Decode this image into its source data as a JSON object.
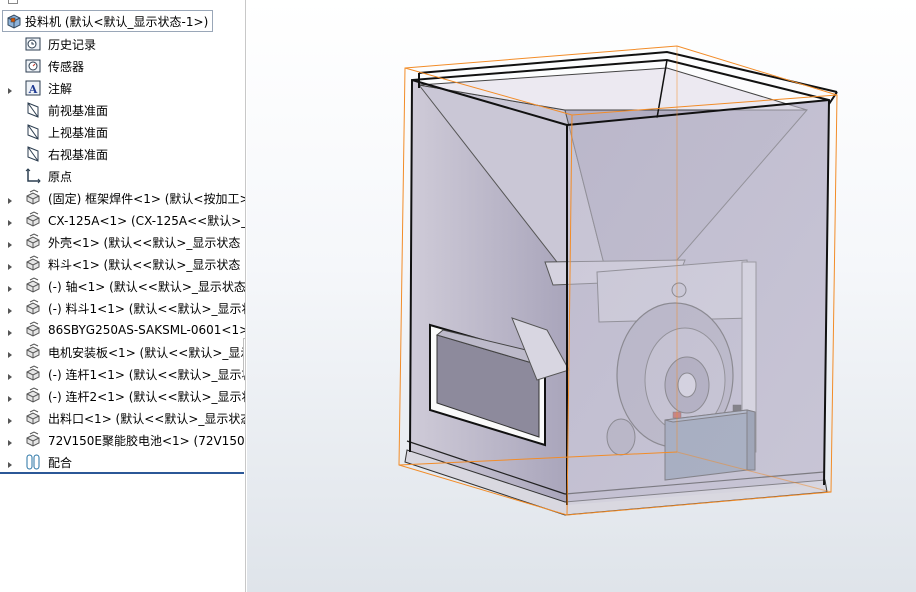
{
  "tree": {
    "root_label": "投料机  (默认<默认_显示状态-1>)",
    "items": [
      {
        "label": "历史记录",
        "icon": "history-icon",
        "expandable": false
      },
      {
        "label": "传感器",
        "icon": "sensor-icon",
        "expandable": false
      },
      {
        "label": "注解",
        "icon": "annotation-icon",
        "expandable": true
      },
      {
        "label": "前视基准面",
        "icon": "plane-icon",
        "expandable": false
      },
      {
        "label": "上视基准面",
        "icon": "plane-icon",
        "expandable": false
      },
      {
        "label": "右视基准面",
        "icon": "plane-icon",
        "expandable": false
      },
      {
        "label": "原点",
        "icon": "origin-icon",
        "expandable": false
      },
      {
        "label": "(固定) 框架焊件<1> (默认<按加工>",
        "icon": "part-icon",
        "expandable": true
      },
      {
        "label": "CX-125A<1> (CX-125A<<默认>_显",
        "icon": "part-icon",
        "expandable": true
      },
      {
        "label": "外壳<1> (默认<<默认>_显示状态 1",
        "icon": "part-icon",
        "expandable": true
      },
      {
        "label": "料斗<1> (默认<<默认>_显示状态 1",
        "icon": "part-icon",
        "expandable": true
      },
      {
        "label": "(-) 轴<1> (默认<<默认>_显示状态 1",
        "icon": "part-icon",
        "expandable": true
      },
      {
        "label": "(-) 料斗1<1> (默认<<默认>_显示状",
        "icon": "part-icon",
        "expandable": true
      },
      {
        "label": "86SBYG250AS-SAKSML-0601<1>",
        "icon": "part-icon",
        "expandable": true
      },
      {
        "label": "电机安装板<1> (默认<<默认>_显示",
        "icon": "part-icon",
        "expandable": true
      },
      {
        "label": "(-) 连杆1<1> (默认<<默认>_显示状",
        "icon": "part-icon",
        "expandable": true
      },
      {
        "label": "(-) 连杆2<1> (默认<<默认>_显示状",
        "icon": "part-icon",
        "expandable": true
      },
      {
        "label": "出料口<1> (默认<<默认>_显示状态",
        "icon": "part-icon",
        "expandable": true
      },
      {
        "label": "72V150E聚能胶电池<1> (72V150E聚",
        "icon": "part-icon",
        "expandable": true
      },
      {
        "label": "配合",
        "icon": "mates-icon",
        "expandable": true
      }
    ]
  },
  "colors": {
    "selection_box": "#f28c28",
    "enclosure_fill": "#b8b5c9",
    "tree_bottom_line": "#2b5797"
  }
}
